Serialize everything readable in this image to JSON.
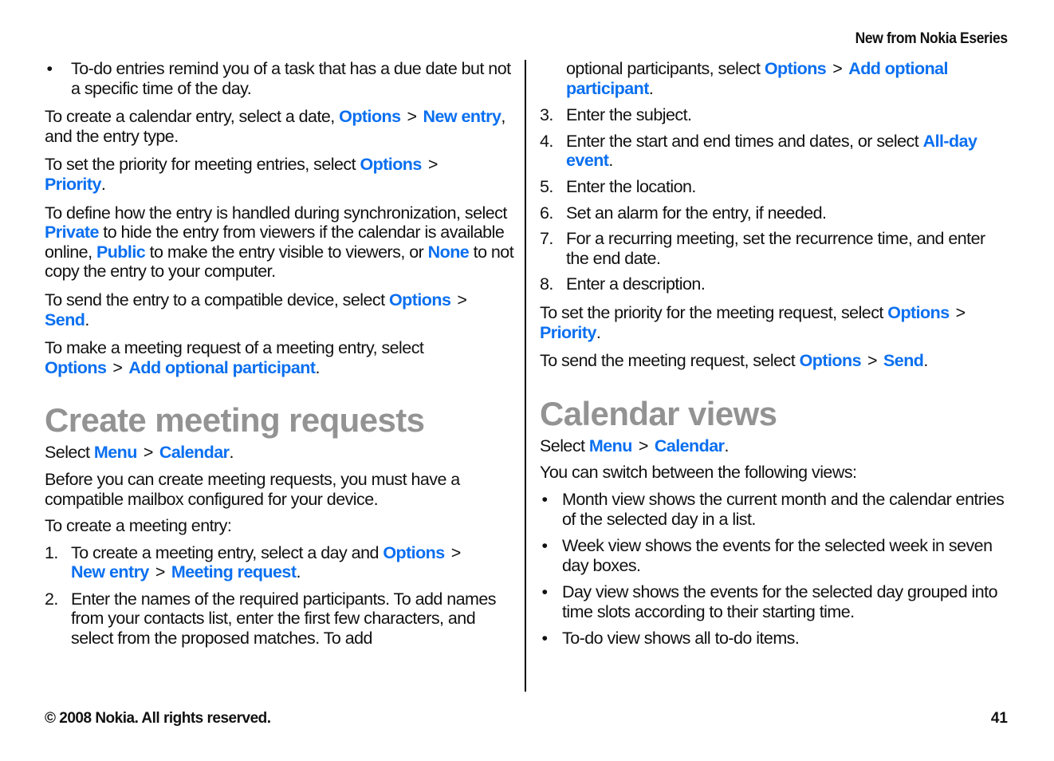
{
  "header": {
    "title": "New from Nokia Eseries"
  },
  "footer": {
    "copyright": "© 2008 Nokia. All rights reserved.",
    "page_number": "41"
  },
  "colors": {
    "link": "#0a6ff0",
    "heading": "#939393",
    "text": "#111111"
  },
  "left_column": {
    "todo_bullet": "To-do entries remind you of a task that has a due date but not a specific time of the day.",
    "create_entry": {
      "pre": "To create a calendar entry, select a date, ",
      "link1": "Options",
      "sep": ">",
      "link2": "New entry",
      "post": ", and the entry type."
    },
    "set_priority": {
      "pre": "To set the priority for meeting entries, select ",
      "link1": "Options",
      "sep": ">",
      "link2": "Priority",
      "post": "."
    },
    "sync": {
      "pre": "To define how the entry is handled during synchronization, select ",
      "link1": "Private",
      "mid1": " to hide the entry from viewers if the calendar is available online, ",
      "link2": "Public",
      "mid2": " to make the entry visible to viewers, or ",
      "link3": "None",
      "post": " to not copy the entry to your computer."
    },
    "send_entry": {
      "pre": "To send the entry to a compatible device, select ",
      "link1": "Options",
      "sep": ">",
      "link2": "Send",
      "post": "."
    },
    "meeting_request": {
      "pre": "To make a meeting request of a meeting entry, select ",
      "link1": "Options",
      "sep": ">",
      "link2": "Add optional participant",
      "post": "."
    },
    "section_heading": "Create meeting requests",
    "select_menu": {
      "pre": "Select ",
      "link1": "Menu",
      "sep": ">",
      "link2": "Calendar",
      "post": "."
    },
    "before": "Before you can create meeting requests, you must have a compatible mailbox configured for your device.",
    "to_create": "To create a meeting entry:",
    "steps": [
      {
        "num": "1.",
        "pre": "To create a meeting entry, select a day and ",
        "link1": "Options",
        "sep1": ">",
        "link2": "New entry",
        "sep2": ">",
        "link3": "Meeting request",
        "post": "."
      },
      {
        "num": "2.",
        "text": "Enter the names of the required participants. To add names from your contacts list, enter the first few characters, and select from the proposed matches. To add"
      }
    ]
  },
  "right_column": {
    "step2_cont": {
      "pre": "optional participants, select ",
      "link1": "Options",
      "sep": ">",
      "link2": "Add optional participant",
      "post": "."
    },
    "steps": [
      {
        "num": "3.",
        "text": "Enter the subject."
      },
      {
        "num": "4.",
        "pre": "Enter the start and end times and dates, or select ",
        "link": "All-day event",
        "post": "."
      },
      {
        "num": "5.",
        "text": "Enter the location."
      },
      {
        "num": "6.",
        "text": "Set an alarm for the entry, if needed."
      },
      {
        "num": "7.",
        "text": "For a recurring meeting, set the recurrence time, and enter the end date."
      },
      {
        "num": "8.",
        "text": "Enter a description."
      }
    ],
    "priority": {
      "pre": "To set the priority for the meeting request, select ",
      "link1": "Options",
      "sep": ">",
      "link2": "Priority",
      "post": "."
    },
    "send": {
      "pre": "To send the meeting request, select ",
      "link1": "Options",
      "sep": ">",
      "link2": "Send",
      "post": "."
    },
    "section_heading": "Calendar views",
    "select_menu": {
      "pre": "Select ",
      "link1": "Menu",
      "sep": ">",
      "link2": "Calendar",
      "post": "."
    },
    "switch_intro": "You can switch between the following views:",
    "views": [
      "Month view shows the current month and the calendar entries of the selected day in a list.",
      "Week view shows the events for the selected week in seven day boxes.",
      "Day view shows the events for the selected day grouped into time slots according to their starting time.",
      "To-do view shows all to-do items."
    ],
    "bullet_glyph": "•"
  }
}
